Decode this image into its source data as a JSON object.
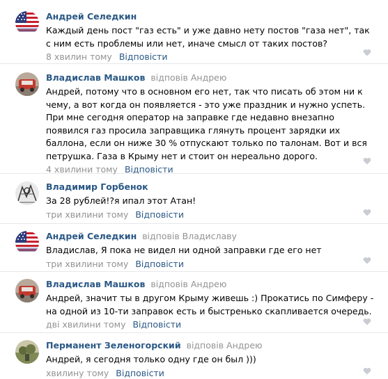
{
  "comments": [
    {
      "author": "Андрей Селедкин",
      "replied_to": "",
      "text": "Каждый день пост \"газ есть\" и уже давно нету постов \"газа нет\", так с ним есть проблемы или нет, иначе смысл от таких постов?",
      "time": "8 хвилин тому",
      "reply_label": "Відповісти",
      "avatar": "flag-avatar"
    },
    {
      "author": "Владислав Машков",
      "replied_to": "відповів Андрею",
      "text": "Андрей, потому что в основном его нет, так что писать об этом ни к чему, а вот когда он появляется - это уже праздник и нужно успеть. При мне сегодня оператор на заправке где недавно внезапно появился газ просила заправщика глянуть процент зарядки их баллона, если он ниже 30 % отпускают только по талонам. Вот и вся петрушка. Газа в Крыму нет и стоит он нереально дорого.",
      "time": "4 хвилини тому",
      "reply_label": "Відповісти",
      "avatar": "car-avatar"
    },
    {
      "author": "Владимир Горбенок",
      "replied_to": "",
      "text": "За 28 рублей!?я ипал этот Атан!",
      "time": "три хвилини тому",
      "reply_label": "Відповісти",
      "avatar": "sketch-avatar"
    },
    {
      "author": "Андрей Селедкин",
      "replied_to": "відповів Владиславу",
      "text": "Владислав, Я пока не видел ни одной заправки где его нет",
      "time": "три хвилини тому",
      "reply_label": "Відповісти",
      "avatar": "flag-avatar"
    },
    {
      "author": "Владислав Машков",
      "replied_to": "відповів Андрею",
      "text": "Андрей, значит ты в другом Крыму живешь :) Прокатись по Симферу - на одной из 10-ти заправок есть и быстренько скапливается очередь.",
      "time": "дві хвилини тому",
      "reply_label": "Відповісти",
      "avatar": "car-avatar"
    },
    {
      "author": "Перманент Зеленогорский",
      "replied_to": "відповів Андрею",
      "text": "Андрей, я сегодня только одну где он был )))",
      "time": "хвилину тому",
      "reply_label": "Відповісти",
      "avatar": "landscape-avatar"
    }
  ],
  "colors": {
    "link": "#2a5885",
    "muted": "#939393",
    "divider": "#e7e8ec",
    "like_icon": "#c9cdd3"
  }
}
